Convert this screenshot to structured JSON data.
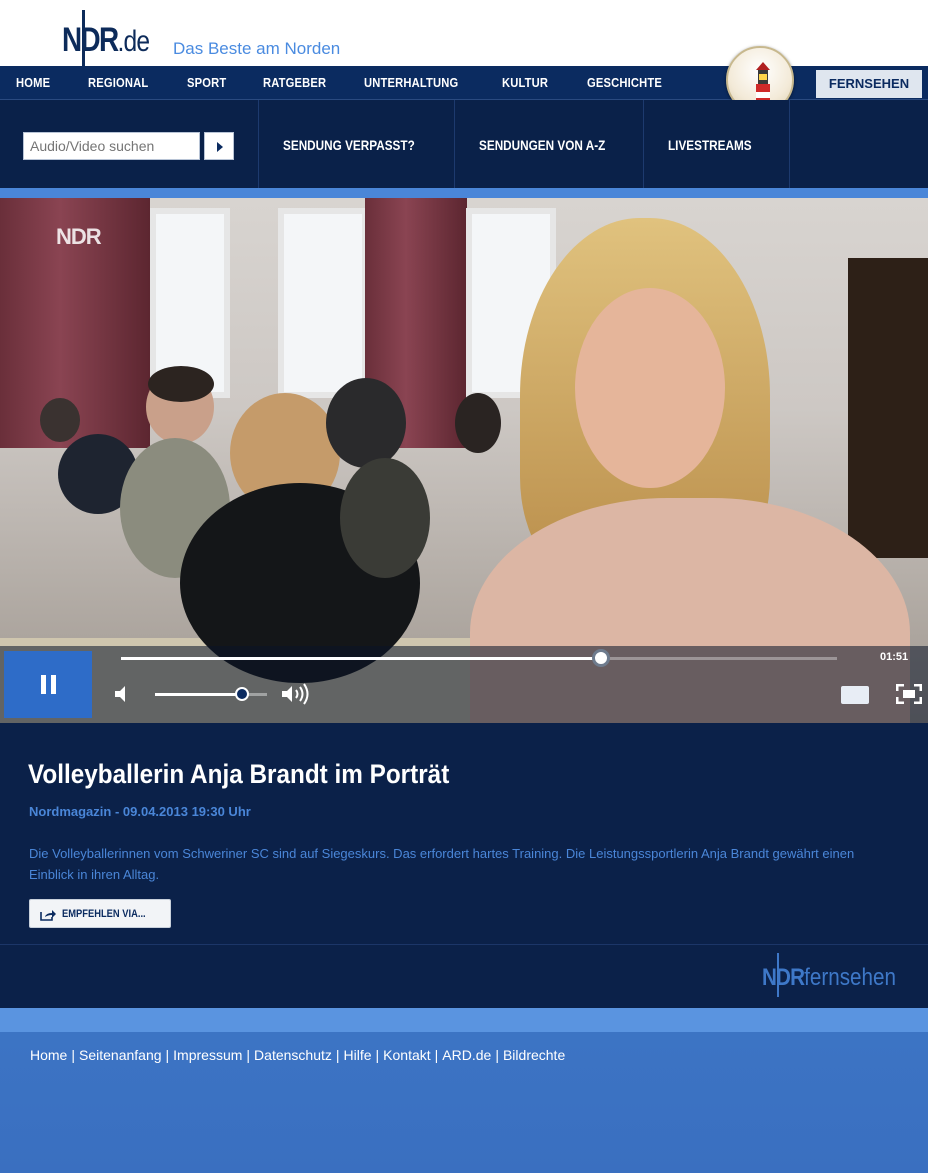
{
  "header": {
    "logo_main": "NDR",
    "logo_suffix": ".de",
    "tagline": "Das Beste am Norden"
  },
  "nav": {
    "items": [
      "HOME",
      "REGIONAL",
      "SPORT",
      "RATGEBER",
      "UNTERHALTUNG",
      "KULTUR",
      "GESCHICHTE"
    ],
    "active": "FERNSEHEN"
  },
  "subnav": {
    "search_placeholder": "Audio/Video suchen",
    "items": [
      "SENDUNG VERPASST?",
      "SENDUNGEN VON A-Z",
      "LIVESTREAMS"
    ]
  },
  "video": {
    "watermark": "NDR",
    "time": "01:51",
    "progress": 0.67,
    "volume": 0.78
  },
  "info": {
    "title": "Volleyballerin Anja Brandt im Porträt",
    "meta": "Nordmagazin - 09.04.2013 19:30 Uhr",
    "description": "Die Volleyballerinnen vom Schweriner SC sind auf Siegeskurs. Das erfordert hartes Training. Die Leistungssportlerin Anja Brandt gewährt einen Einblick in ihren Alltag.",
    "share_label": "EMPFEHLEN VIA...",
    "brand_a": "NDR",
    "brand_b": "fernsehen"
  },
  "footer": {
    "links": [
      "Home",
      "Seitenanfang",
      "Impressum",
      "Datenschutz",
      "Hilfe",
      "Kontakt",
      "ARD.de",
      "Bildrechte"
    ]
  },
  "colors": {
    "navy": "#0b2b60",
    "deep_navy": "#0a2149",
    "accent_blue": "#4a86d8",
    "footer_blue": "#3c74c4",
    "play_blue": "#2e6cc8"
  }
}
